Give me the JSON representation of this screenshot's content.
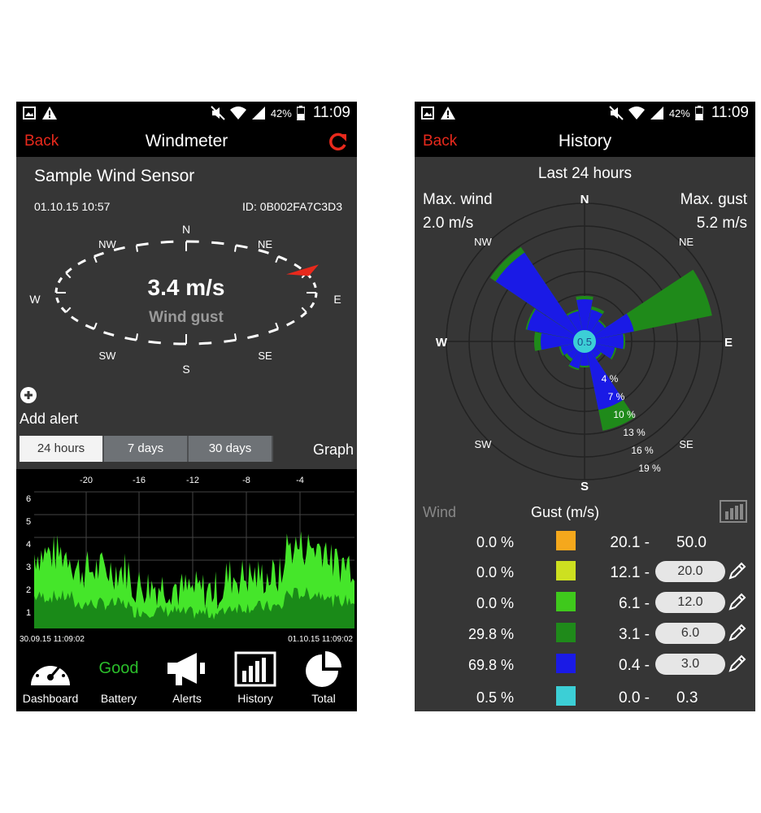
{
  "status": {
    "battery_pct": "42%",
    "time": "11:09"
  },
  "left": {
    "back_label": "Back",
    "title": "Windmeter",
    "sensor_name": "Sample Wind Sensor",
    "date": "01.10.15  10:57",
    "id": "ID: 0B002FA7C3D3",
    "compass": {
      "N": "N",
      "NE": "NE",
      "E": "E",
      "SE": "SE",
      "S": "S",
      "SW": "SW",
      "W": "W",
      "NW": "NW",
      "speed": "3.4 m/s",
      "label": "Wind gust",
      "direction_deg": 65
    },
    "add_alert": "Add alert",
    "ranges": [
      "24 hours",
      "7 days",
      "30 days"
    ],
    "active_range": 0,
    "graph_label": "Graph",
    "graph": {
      "x_ticks": [
        "-20",
        "-16",
        "-12",
        "-8",
        "-4"
      ],
      "y_ticks": [
        "1",
        "2",
        "3",
        "4",
        "5",
        "6"
      ],
      "start": "30.09.15  11:09:02",
      "end": "01.10.15  11:09:02"
    },
    "tabs": [
      "Dashboard",
      "Battery",
      "Alerts",
      "History",
      "Total"
    ],
    "battery_status": "Good"
  },
  "right": {
    "back_label": "Back",
    "title": "History",
    "period": "Last 24 hours",
    "max_wind_label": "Max. wind",
    "max_wind_value": "2.0   m/s",
    "max_gust_label": "Max. gust",
    "max_gust_value": "5.2  m/s",
    "rose": {
      "N": "N",
      "NE": "NE",
      "E": "E",
      "SE": "SE",
      "S": "S",
      "SW": "SW",
      "W": "W",
      "NW": "NW",
      "center": "0.5",
      "rings": [
        "4 %",
        "7 %",
        "10 %",
        "13 %",
        "16 %",
        "19 %"
      ]
    },
    "legend_wind": "Wind",
    "legend_gust": "Gust (m/s)",
    "legend": [
      {
        "pct": "0.0 %",
        "color": "#f5a81c",
        "min": "20.1 -",
        "max": "50.0",
        "editable": false
      },
      {
        "pct": "0.0 %",
        "color": "#cde020",
        "min": "12.1 -",
        "max": "20.0",
        "editable": true
      },
      {
        "pct": "0.0 %",
        "color": "#3fc91c",
        "min": "6.1 -",
        "max": "12.0",
        "editable": true
      },
      {
        "pct": "29.8 %",
        "color": "#1f8a1a",
        "min": "3.1 -",
        "max": "6.0",
        "editable": true
      },
      {
        "pct": "69.8 %",
        "color": "#1a1ae6",
        "min": "0.4 -",
        "max": "3.0",
        "editable": true
      },
      {
        "pct": "0.5 %",
        "color": "#3ccfd6",
        "min": "0.0 -",
        "max": "0.3",
        "editable": false
      }
    ]
  }
}
